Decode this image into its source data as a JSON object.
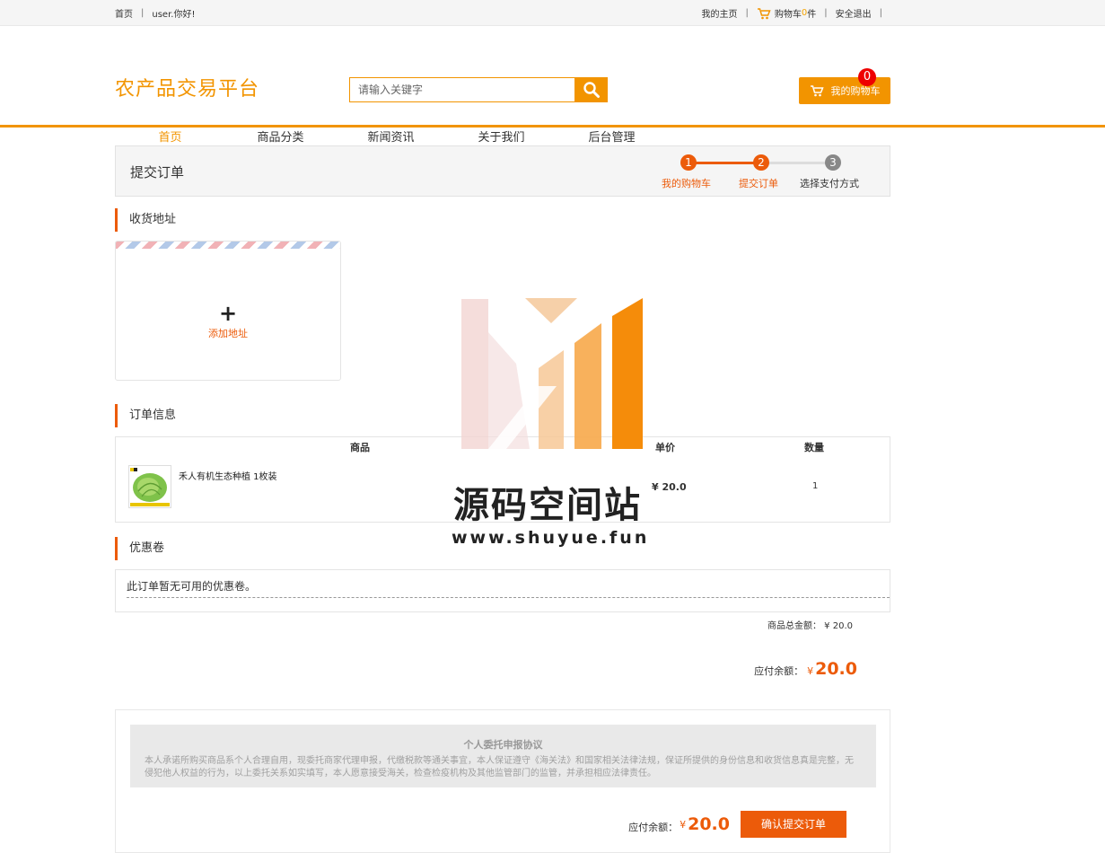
{
  "topbar": {
    "home": "首页",
    "greeting": "user.你好!",
    "my_page": "我的主页",
    "cart_prefix": "购物车",
    "cart_count": "0",
    "cart_suffix": "件",
    "logout": "安全退出"
  },
  "header": {
    "logo": "农产品交易平台",
    "search_placeholder": "请输入关键字",
    "cart_button": "我的购物车",
    "cart_badge": "0"
  },
  "nav": {
    "items": [
      "首页",
      "商品分类",
      "新闻资讯",
      "关于我们",
      "后台管理"
    ],
    "active_index": 0
  },
  "steps": {
    "page_title": "提交订单",
    "items": [
      {
        "num": "1",
        "label": "我的购物车"
      },
      {
        "num": "2",
        "label": "提交订单"
      },
      {
        "num": "3",
        "label": "选择支付方式"
      }
    ]
  },
  "address": {
    "section_title": "收货地址",
    "plus": "+",
    "add_label": "添加地址"
  },
  "order": {
    "section_title": "订单信息",
    "col_product": "商品",
    "col_price": "单价",
    "col_qty": "数量",
    "item": {
      "name": "禾人有机生态种植 1枚装",
      "price": "¥ 20.0",
      "qty": "1"
    }
  },
  "coupon": {
    "section_title": "优惠卷",
    "empty_text": "此订单暂无可用的优惠卷。"
  },
  "totals": {
    "goods_total": "商品总金额： ¥ 20.0",
    "payable_label": "应付余额：",
    "currency": "¥",
    "payable_amount": "20.0"
  },
  "agreement": {
    "title": "个人委托申报协议",
    "text": "本人承诺所购买商品系个人合理自用，现委托商家代理申报，代缴税款等通关事宜，本人保证遵守《海关法》和国家相关法律法规，保证所提供的身份信息和收货信息真是完整，无侵犯他人权益的行为，以上委托关系如实填写，本人愿意接受海关，检查检疫机构及其他监管部门的监管，并承担相应法律责任。"
  },
  "submit": {
    "payable_label": "应付余额：",
    "currency": "¥",
    "amount": "20.0",
    "button": "确认提交订单"
  },
  "watermark": {
    "title": "源码空间站",
    "url": "www.shuyue.fun"
  },
  "colors": {
    "accent": "#f29400",
    "accent_dark": "#ec5b0a",
    "step_inactive": "#888888"
  }
}
